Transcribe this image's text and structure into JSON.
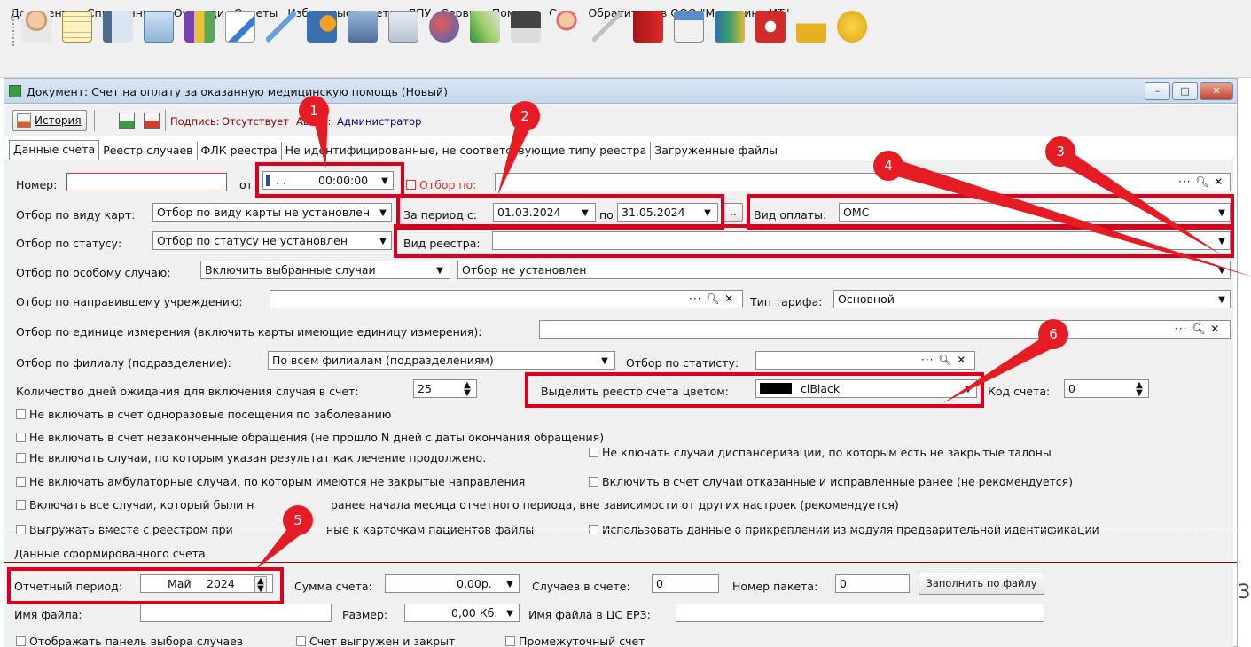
{
  "menu": [
    "Документы",
    "Справочники",
    "Очереди",
    "Отчеты",
    "Избранные отчеты",
    "ЛПУ",
    "Сервис",
    "Помощь",
    "Окна",
    "Обратиться в ООО \"Медицина-ИТ\""
  ],
  "toolbar_icons": [
    "doctor-icon",
    "notebook-icon",
    "document-list-icon",
    "card-icon",
    "flasks-icon",
    "edit-icon",
    "syringe-icon",
    "schedule-icon",
    "building-icon",
    "first-aid-icon",
    "globe-icon",
    "tent-icon",
    "scanner-icon",
    "nurse-icon",
    "thermometer-icon",
    "red-book-icon",
    "calendar-icon",
    "data-book-icon",
    "pdf-icon",
    "lock-icon",
    "chat-icon"
  ],
  "window": {
    "title": "Документ: Счет на оплату за оказанную медицинскую помощь (Новый)",
    "history_button": "История",
    "signature_label": "Подпись:",
    "signature_value": "Отсутствует",
    "author_label": "Автор:",
    "author_value": "Администратор"
  },
  "tabs": [
    "Данные счета",
    "Реестр случаев",
    "ФЛК реестра",
    "Не идентифицированные, не соответствующие типу реестра",
    "Загруженные файлы"
  ],
  "form": {
    "number_label": "Номер:",
    "number_value": "",
    "from_label": "от",
    "from_date": ". .",
    "from_time": "00:00:00",
    "filter_by_label": "Отбор по:",
    "card_type_label": "Отбор по виду карт:",
    "card_type_value": "Отбор по виду карты не установлен",
    "period_label": "За период с:",
    "period_from": "01.03.2024",
    "period_to_label": "по",
    "period_to": "31.05.2024",
    "period_more": "..",
    "payment_type_label": "Вид оплаты:",
    "payment_type_value": "ОМС",
    "status_label": "Отбор по статусу:",
    "status_value": "Отбор по статусу не установлен",
    "registry_type_label": "Вид реестра:",
    "registry_type_value": "",
    "special_case_label": "Отбор по особому случаю:",
    "special_case_value": "Включить выбранные случаи",
    "special_case_filter": "Отбор не установлен",
    "referring_label": "Отбор по направившему учреждению:",
    "referring_value": "",
    "tariff_label": "Тип тарифа:",
    "tariff_value": "Основной",
    "unit_label": "Отбор по единице измерения (включить карты имеющие единицу измерения):",
    "unit_value": "",
    "branch_label": "Отбор по филиалу (подразделение):",
    "branch_value": "По всем филиалам (подразделениям)",
    "statistician_label": "Отбор по статисту:",
    "statistician_value": "",
    "wait_days_label": "Количество дней ожидания для включения случая в счет:",
    "wait_days_value": "25",
    "color_label": "Выделить реестр счета цветом:",
    "color_value": "clBlack",
    "invoice_code_label": "Код счета:",
    "invoice_code_value": "0"
  },
  "checkboxes": [
    "Не включать в счет одноразовые посещения по заболеванию",
    "Не включать в счет незаконченные обращения (не прошло N дней с даты окончания обращения)",
    "Не включать случаи, по которым указан результат как лечение продолжено.",
    "Не ключать случаи диспансеризации, по которым есть не закрытые талоны",
    "Не включать амбулаторные случаи, по которым имеются не закрытые направления",
    "Включить в счет случаи отказанные и исправленные ранее (не рекомендуется)",
    "Включать все случаи, который были н",
    "ранее начала месяца отчетного периода, вне зависимости от других настроек (рекомендуется)",
    "Выгружать вместе с реестром при",
    "ные к карточкам пациентов файлы",
    "Использовать данные о прикреплении из модуля предварительной идентификации"
  ],
  "generated": {
    "section_label": "Данные сформированного счета",
    "report_period_label": "Отчетный период:",
    "report_month": "Май",
    "report_year": "2024",
    "sum_label": "Сумма счета:",
    "sum_value": "0,00р.",
    "cases_label": "Случаев в счете:",
    "cases_value": "0",
    "packet_label": "Номер пакета:",
    "packet_value": "0",
    "fill_button": "Заполнить по файлу",
    "filename_label": "Имя файла:",
    "filename_value": "",
    "size_label": "Размер:",
    "size_value": "0,00 Кб.",
    "erz_label": "Имя файла в ЦС ЕРЗ:",
    "erz_value": ""
  },
  "bottom_checkboxes": [
    "Отображать панель выбора случаев",
    "Счет выгружен и закрыт",
    "Промежуточный счет"
  ],
  "side_letter": "З",
  "markers": [
    "1",
    "2",
    "3",
    "4",
    "5",
    "6"
  ],
  "colors": {
    "highlight": "#d8001c",
    "marker": "#e61c24",
    "required": "#e03131"
  }
}
